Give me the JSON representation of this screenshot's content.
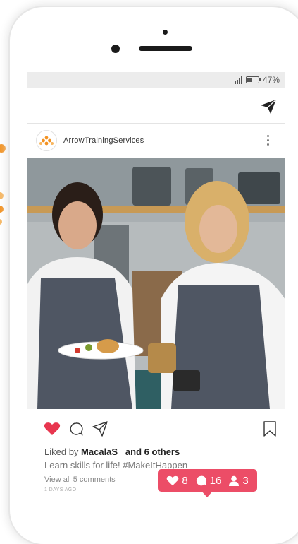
{
  "status_bar": {
    "battery": "47%",
    "battery_level": 0.47
  },
  "post": {
    "username": "ArrowTrainingServices",
    "liked_by_prefix": "Liked by ",
    "liked_by_user": "MacalaS_",
    "liked_by_suffix": " and 6 others",
    "caption": "Learn skills for life! #MakeItHappen",
    "view_comments": "View all 5 comments",
    "timestamp": "1 DAYS AGO"
  },
  "notification": {
    "likes": "8",
    "comments": "16",
    "followers": "3"
  },
  "colors": {
    "accent": "#ec4d67",
    "heart": "#e8364f",
    "brand_orange": "#f39221"
  }
}
